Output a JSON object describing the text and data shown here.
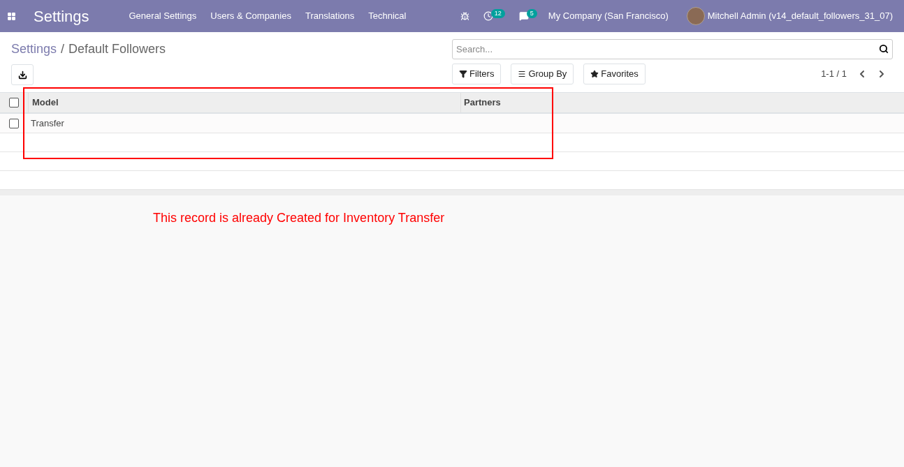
{
  "navbar": {
    "app_title": "Settings",
    "menu": [
      "General Settings",
      "Users & Companies",
      "Translations",
      "Technical"
    ],
    "activity_count": "12",
    "message_count": "5",
    "company": "My Company (San Francisco)",
    "user": "Mitchell Admin (v14_default_followers_31_07)"
  },
  "breadcrumb": {
    "parent": "Settings",
    "separator": "/",
    "current": "Default Followers"
  },
  "search": {
    "placeholder": "Search..."
  },
  "filters": [
    "Filters",
    "Group By",
    "Favorites"
  ],
  "pager": "1-1 / 1",
  "table": {
    "select_all": {
      "checked": false
    },
    "columns": [
      "Model",
      "Partners"
    ],
    "rows": [
      {
        "model": "Transfer",
        "selected": false
      }
    ]
  },
  "annotation": "This record is already Created for Inventory Transfer"
}
